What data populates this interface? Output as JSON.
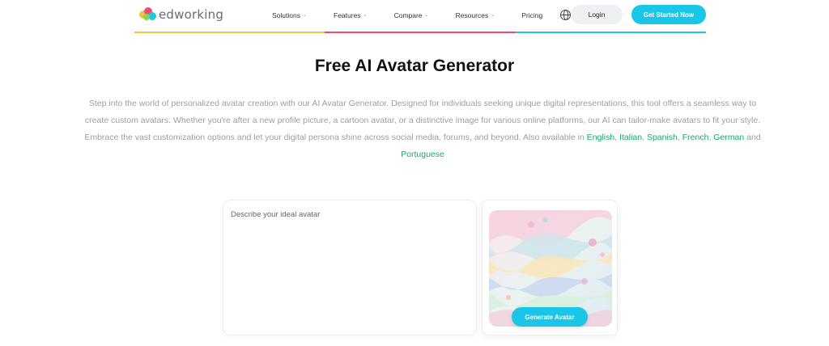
{
  "header": {
    "logo_text": "edworking",
    "nav": [
      {
        "label": "Solutions",
        "has_dropdown": true
      },
      {
        "label": "Features",
        "has_dropdown": true
      },
      {
        "label": "Compare",
        "has_dropdown": true
      },
      {
        "label": "Resources",
        "has_dropdown": true
      },
      {
        "label": "Pricing",
        "has_dropdown": false
      }
    ],
    "login_label": "Login",
    "cta_label": "Get Started Now",
    "accent_colors": [
      "#f5c23b",
      "#ee4a73",
      "#1fc7de"
    ]
  },
  "hero": {
    "title": "Free AI Avatar Generator",
    "description": "Step into the world of personalized avatar creation with our AI Avatar Generator. Designed for individuals seeking unique digital representations, this tool offers a seamless way to create custom avatars. Whether you're after a new profile picture, a cartoon avatar, or a distinctive image for various online platforms, our AI can tailor-make avatars to fit your style. Embrace the vast customization options and let your digital persona shine across social media, forums, and beyond. Also available in",
    "languages": [
      "English",
      "Italian",
      "Spanish",
      "French",
      "German",
      "Portuguese"
    ],
    "sep_comma": ", ",
    "sep_and": " and "
  },
  "generator": {
    "prompt_placeholder": "Describe your ideal avatar",
    "prompt_value": "",
    "generate_label": "Generate Avatar"
  },
  "colors": {
    "brand_cyan": "#19c6e8",
    "link_green": "#1ea66b"
  },
  "icons": [
    "chevron-down-icon",
    "globe-icon"
  ]
}
